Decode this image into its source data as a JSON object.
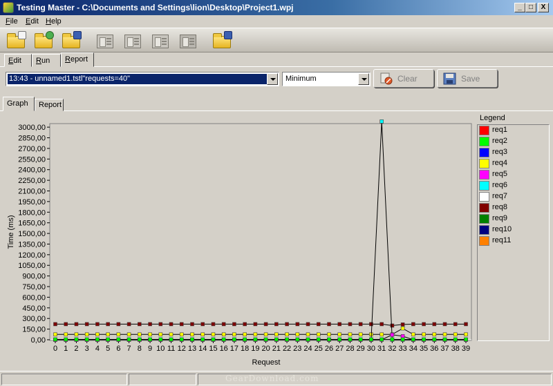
{
  "window": {
    "title": "Testing Master - C:\\Documents and Settings\\lion\\Desktop\\Project1.wpj",
    "controls": [
      "_",
      "□",
      "X"
    ]
  },
  "menu": [
    {
      "label": "File",
      "underline": "F",
      "rest": "ile"
    },
    {
      "label": "Edit",
      "underline": "E",
      "rest": "dit"
    },
    {
      "label": "Help",
      "underline": "H",
      "rest": "elp"
    }
  ],
  "toolbar": {
    "icons": [
      "new-project-icon",
      "open-project-icon",
      "save-project-icon",
      "new-test-icon",
      "edit-test-icon",
      "run-test-icon",
      "delete-test-icon",
      "save-report-icon"
    ]
  },
  "main_tabs": [
    {
      "label": "Edit",
      "underline": "E",
      "rest": "dit",
      "active": false
    },
    {
      "label": "Run",
      "underline": "R",
      "rest": "un",
      "active": false
    },
    {
      "label": "Report",
      "underline": "R",
      "rest": "eport",
      "active": true
    }
  ],
  "report_controls": {
    "test_select_value": "13:43 - unnamed1.tstl\"requests=40\"",
    "mode_select_value": "Minimum",
    "clear_label": "Clear",
    "save_label": "Save"
  },
  "sub_tabs": [
    {
      "label": "Graph",
      "active": true
    },
    {
      "label": "Report",
      "active": false
    }
  ],
  "legend": {
    "title": "Legend",
    "items": [
      {
        "name": "req1",
        "color": "#ff0000"
      },
      {
        "name": "req2",
        "color": "#00ff00"
      },
      {
        "name": "req3",
        "color": "#0000ff"
      },
      {
        "name": "req4",
        "color": "#ffff00"
      },
      {
        "name": "req5",
        "color": "#ff00ff"
      },
      {
        "name": "req6",
        "color": "#00ffff"
      },
      {
        "name": "req7",
        "color": "#ffffff"
      },
      {
        "name": "req8",
        "color": "#800000"
      },
      {
        "name": "req9",
        "color": "#008000"
      },
      {
        "name": "req10",
        "color": "#000080"
      },
      {
        "name": "req11",
        "color": "#ff8000"
      }
    ]
  },
  "chart_data": {
    "type": "line",
    "xlabel": "Request",
    "ylabel": "Time (ms)",
    "x": [
      0,
      1,
      2,
      3,
      4,
      5,
      6,
      7,
      8,
      9,
      10,
      11,
      12,
      13,
      14,
      15,
      16,
      17,
      18,
      19,
      20,
      21,
      22,
      23,
      24,
      25,
      26,
      27,
      28,
      29,
      30,
      31,
      32,
      33,
      34,
      35,
      36,
      37,
      38,
      39
    ],
    "yticks": [
      "0,00",
      "150,00",
      "300,00",
      "450,00",
      "600,00",
      "750,00",
      "900,00",
      "1050,00",
      "1200,00",
      "1350,00",
      "1500,00",
      "1650,00",
      "1800,00",
      "1950,00",
      "2100,00",
      "2250,00",
      "2400,00",
      "2550,00",
      "2700,00",
      "2850,00",
      "3000,00"
    ],
    "ylim": [
      0,
      3050
    ],
    "grid": false,
    "series": [
      {
        "name": "req8",
        "color": "#800000",
        "values": [
          220,
          220,
          220,
          220,
          220,
          220,
          220,
          220,
          220,
          220,
          220,
          220,
          220,
          220,
          220,
          220,
          220,
          220,
          220,
          220,
          220,
          220,
          220,
          220,
          220,
          220,
          220,
          220,
          220,
          220,
          220,
          220,
          200,
          215,
          220,
          220,
          220,
          220,
          220,
          220
        ]
      },
      {
        "name": "req4",
        "color": "#ffff00",
        "values": [
          75,
          75,
          75,
          75,
          75,
          75,
          75,
          75,
          75,
          75,
          75,
          75,
          75,
          75,
          75,
          75,
          75,
          75,
          75,
          75,
          75,
          75,
          75,
          75,
          75,
          75,
          75,
          75,
          75,
          75,
          75,
          75,
          75,
          160,
          75,
          75,
          75,
          75,
          75,
          75
        ]
      },
      {
        "name": "req6",
        "color": "#00ffff",
        "values": [
          0,
          0,
          0,
          0,
          0,
          0,
          0,
          0,
          0,
          0,
          0,
          0,
          0,
          0,
          0,
          0,
          0,
          0,
          0,
          0,
          0,
          0,
          0,
          0,
          0,
          0,
          0,
          0,
          0,
          0,
          0,
          3080,
          0,
          0,
          0,
          0,
          0,
          0,
          0,
          0
        ]
      },
      {
        "name": "req5",
        "color": "#ff00ff",
        "values": [
          0,
          0,
          0,
          0,
          0,
          0,
          0,
          0,
          0,
          0,
          0,
          0,
          0,
          0,
          0,
          0,
          0,
          0,
          0,
          0,
          0,
          0,
          0,
          0,
          0,
          0,
          0,
          0,
          0,
          0,
          0,
          0,
          70,
          50,
          0,
          0,
          0,
          0,
          0,
          0
        ]
      },
      {
        "name": "req2",
        "color": "#00ff00",
        "values": [
          5,
          5,
          5,
          5,
          5,
          5,
          5,
          5,
          5,
          5,
          5,
          5,
          5,
          5,
          5,
          5,
          5,
          5,
          5,
          5,
          5,
          5,
          5,
          5,
          5,
          5,
          5,
          5,
          5,
          5,
          5,
          5,
          5,
          5,
          5,
          5,
          5,
          5,
          5,
          5
        ]
      }
    ]
  },
  "status": {
    "watermark": "GearDownload.com"
  }
}
